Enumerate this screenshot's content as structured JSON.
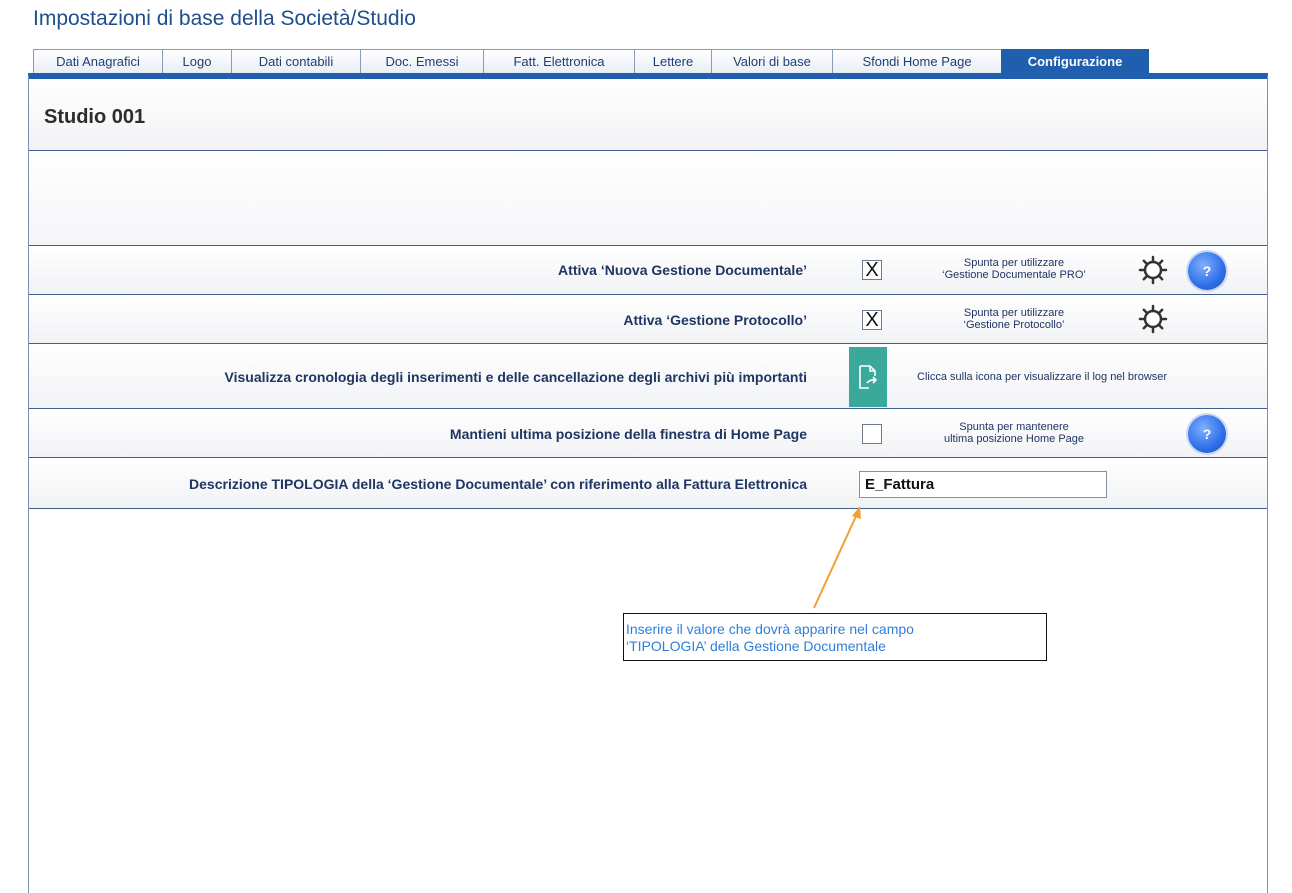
{
  "page": {
    "title": "Impostazioni  di base della Società/Studio"
  },
  "tabs": [
    {
      "label": "Dati Anagrafici"
    },
    {
      "label": "Logo"
    },
    {
      "label": "Dati contabili"
    },
    {
      "label": "Doc. Emessi"
    },
    {
      "label": "Fatt. Elettronica"
    },
    {
      "label": "Lettere"
    },
    {
      "label": "Valori di base"
    },
    {
      "label": "Sfondi Home Page"
    },
    {
      "label": "Configurazione",
      "active": true
    }
  ],
  "studio": {
    "name": "Studio 001"
  },
  "settings": {
    "nuova_gestione": {
      "label": "Attiva ‘Nuova Gestione Documentale’",
      "checked": true,
      "check_mark": "X",
      "hint_line1": "Spunta per utilizzare",
      "hint_line2": "‘Gestione Documentale PRO’",
      "icons": [
        "gear-icon",
        "help-icon"
      ]
    },
    "protocollo": {
      "label": "Attiva ‘Gestione Protocollo’",
      "checked": true,
      "check_mark": "X",
      "hint_line1": "Spunta per utilizzare",
      "hint_line2": "‘Gestione Protocollo’",
      "icons": [
        "gear-icon"
      ]
    },
    "cronologia": {
      "label": "Visualizza cronologia degli inserimenti e delle cancellazione degli archivi più importanti",
      "hint": "Clicca sulla icona per visualizzare il log nel browser",
      "icons": [
        "open-log-icon"
      ]
    },
    "posizione": {
      "label": "Mantieni ultima posizione della finestra di Home Page",
      "checked": false,
      "check_mark": "",
      "hint_line1": "Spunta per mantenere",
      "hint_line2": "ultima posizione Home Page",
      "icons": [
        "help-icon"
      ]
    },
    "tipologia": {
      "label": "Descrizione TIPOLOGIA della ‘Gestione Documentale’ con riferimento alla Fattura Elettronica",
      "value": "E_Fattura"
    }
  },
  "annotation": {
    "line1": "Inserire il valore che dovrà apparire nel campo",
    "line2": "‘TIPOLOGIA’ della Gestione Documentale"
  },
  "help_label": "?",
  "colors": {
    "accent": "#1f5fae",
    "title": "#1f4e8c",
    "label": "#1f3563",
    "log_button": "#3aa89a",
    "help_button": "#2f6ee8",
    "annotation_arrow": "#f0a030",
    "annotation_text": "#2f7fd8"
  }
}
